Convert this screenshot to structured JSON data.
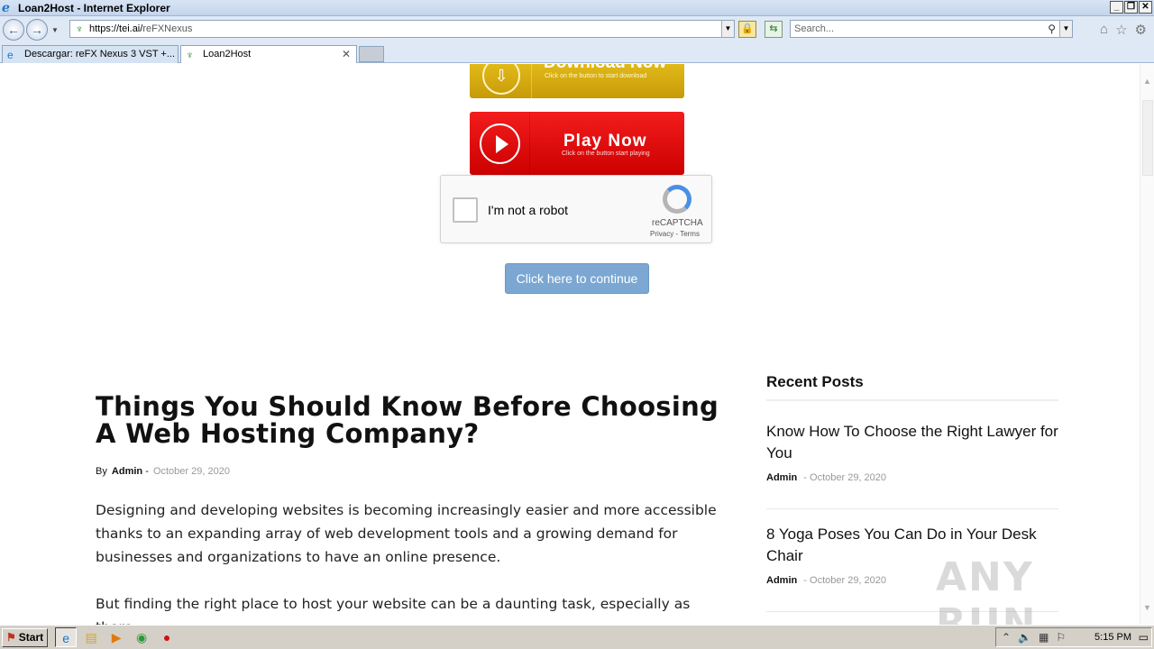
{
  "window": {
    "title": "Loan2Host - Internet Explorer",
    "ie_icon": "e"
  },
  "nav": {
    "url_host": "https://tei.ai/",
    "url_path": "reFXNexus",
    "search_placeholder": "Search..."
  },
  "tabs": [
    {
      "label": "Descargar: reFX Nexus 3 VST +...",
      "active": false
    },
    {
      "label": "Loan2Host",
      "active": true
    }
  ],
  "page": {
    "download_button": {
      "title": "Download Now",
      "subtitle": "Click on the button to start download"
    },
    "play_button": {
      "title": "Play Now",
      "subtitle": "Click on the button start playing"
    },
    "captcha": {
      "label": "I'm not a robot",
      "brand": "reCAPTCHA",
      "links": "Privacy - Terms"
    },
    "continue_label": "Click here to continue",
    "article": {
      "title": "Things You Should Know Before Choosing A Web Hosting Company?",
      "by": "By",
      "author": "Admin",
      "separator": "-",
      "date": "October 29, 2020",
      "paragraphs": [
        "Designing and developing websites is becoming increasingly easier and more accessible thanks to an expanding array of web development tools and a growing demand for businesses and organizations to have an online presence.",
        "But finding the right place to host your website can be a daunting task, especially as there"
      ]
    },
    "sidebar": {
      "heading": "Recent Posts",
      "posts": [
        {
          "title": "Know How To Choose the Right Lawyer for You",
          "author": "Admin",
          "date": "- October 29, 2020"
        },
        {
          "title": "8 Yoga Poses You Can Do in Your Desk Chair",
          "author": "Admin",
          "date": "- October 29, 2020"
        }
      ]
    },
    "watermark": "ANY RUN"
  },
  "taskbar": {
    "start_label": "Start",
    "clock": "5:15 PM"
  }
}
